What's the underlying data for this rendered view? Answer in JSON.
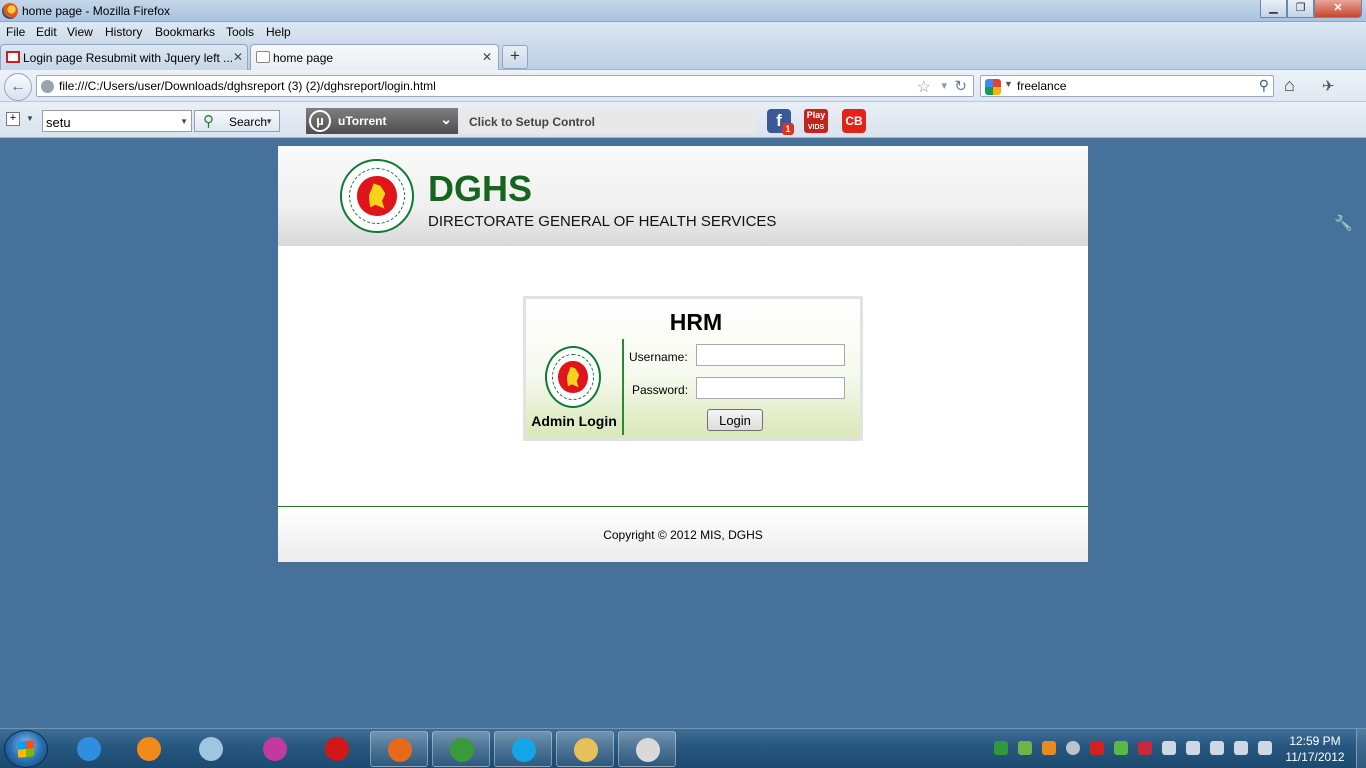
{
  "window": {
    "title": "home page - Mozilla Firefox",
    "minimize": "▁",
    "maximize": "❐",
    "close": "✕"
  },
  "menu": {
    "file": "File",
    "edit": "Edit",
    "view": "View",
    "history": "History",
    "bookmarks": "Bookmarks",
    "tools": "Tools",
    "help": "Help"
  },
  "tabs": [
    {
      "label": "Login page Resubmit with Jquery left ...",
      "icon": "gmail-icon",
      "active": false
    },
    {
      "label": "home page",
      "icon": "blank-page-icon",
      "active": true
    }
  ],
  "navbar": {
    "url": "file:///C:/Users/user/Downloads/dghsreport (3) (2)/dghsreport/login.html",
    "search_query": "freelance"
  },
  "toolbar": {
    "search_value": "setu",
    "search_button": "Search",
    "utorrent_label": "uTorrent",
    "setup_label": "Click to Setup Control",
    "facebook_badge": "1",
    "play_label_top": "Play",
    "play_label_bottom": "VIDS",
    "cb_label": "CB"
  },
  "page": {
    "brand_title": "DGHS",
    "brand_subtitle": "DIRECTORATE GENERAL OF HEALTH SERVICES",
    "login": {
      "title": "HRM",
      "side_label": "Admin Login",
      "username_label": "Username:",
      "password_label": "Password:",
      "username_value": "",
      "password_value": "",
      "submit_label": "Login"
    },
    "footer": "Copyright © 2012 MIS, DGHS"
  },
  "taskbar": {
    "apps": [
      {
        "name": "internet-explorer-icon",
        "open": false,
        "color": "#2f8fde"
      },
      {
        "name": "media-player-icon",
        "open": false,
        "color": "#f08a1a"
      },
      {
        "name": "notepad-icon",
        "open": false,
        "color": "#9fc6e0"
      },
      {
        "name": "wand-icon",
        "open": false,
        "color": "#c23aa0"
      },
      {
        "name": "opera-icon",
        "open": false,
        "color": "#d01818"
      },
      {
        "name": "firefox-icon",
        "open": true,
        "color": "#e86a18"
      },
      {
        "name": "chrome-icon",
        "open": true,
        "color": "#3a9a3a"
      },
      {
        "name": "skype-icon",
        "open": true,
        "color": "#12a5e8"
      },
      {
        "name": "explorer-folder-icon",
        "open": true,
        "color": "#e6c15a"
      },
      {
        "name": "paint-icon",
        "open": true,
        "color": "#d9d9d9"
      }
    ],
    "time": "12:59 PM",
    "date": "11/17/2012"
  }
}
